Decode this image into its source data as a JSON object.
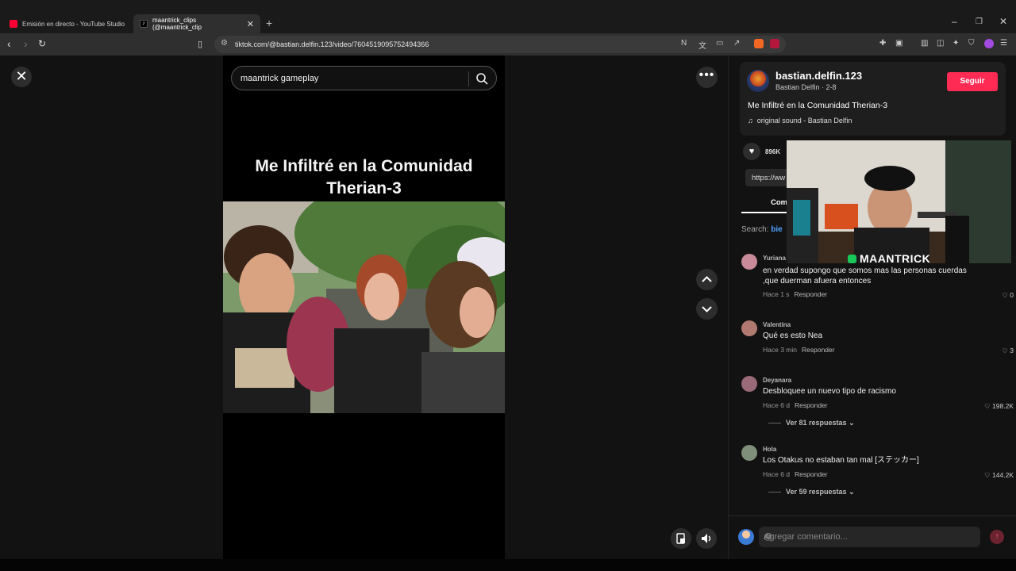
{
  "browser": {
    "tabs": [
      {
        "label": "Emisión en directo - YouTube Studio"
      },
      {
        "label": "maantrick_clips (@maantrick_clip"
      }
    ],
    "new_tab": "+",
    "url": "tiktok.com/@bastian.delfin.123/video/7604519095752494366"
  },
  "player": {
    "search_query": "maantrick gameplay",
    "video_title": "Me Infiltré en la Comunidad Therian-3"
  },
  "author": {
    "username": "bastian.delfin.123",
    "subtitle": "Bastian Delfin · 2-8",
    "follow_label": "Seguir",
    "description": "Me Infiltré en la Comunidad Therian-3",
    "sound": "original sound - Bastian Delfin"
  },
  "stats": {
    "likes": "896K",
    "link_preview": "https://ww"
  },
  "comments_tab": {
    "label": "Com",
    "search_prefix": "Search:",
    "search_term": "bie"
  },
  "overlay": {
    "brand": "MAANTRICK"
  },
  "comments": [
    {
      "user": "Yuriana",
      "text": "en verdad supongo que somos mas las personas cuerdas ,que duerman afuera entonces",
      "time": "Hace 1 s",
      "reply": "Responder",
      "likes": "0"
    },
    {
      "user": "Valentina",
      "text": "Qué es esto Nea",
      "time": "Hace 3 min",
      "reply": "Responder",
      "likes": "3"
    },
    {
      "user": "Deyanara",
      "text": "Desbloquee un nuevo tipo de racismo",
      "time": "Hace 6 d",
      "reply": "Responder",
      "likes": "198.2K",
      "more": "Ver 81 respuestas"
    },
    {
      "user": "Hola",
      "text": "Los Otakus no estaban tan mal [ステッカー]",
      "time": "Hace 6 d",
      "reply": "Responder",
      "likes": "144.2K",
      "more": "Ver 59 respuestas"
    }
  ],
  "composer": {
    "placeholder": "Agregar comentario...",
    "at": "@"
  }
}
